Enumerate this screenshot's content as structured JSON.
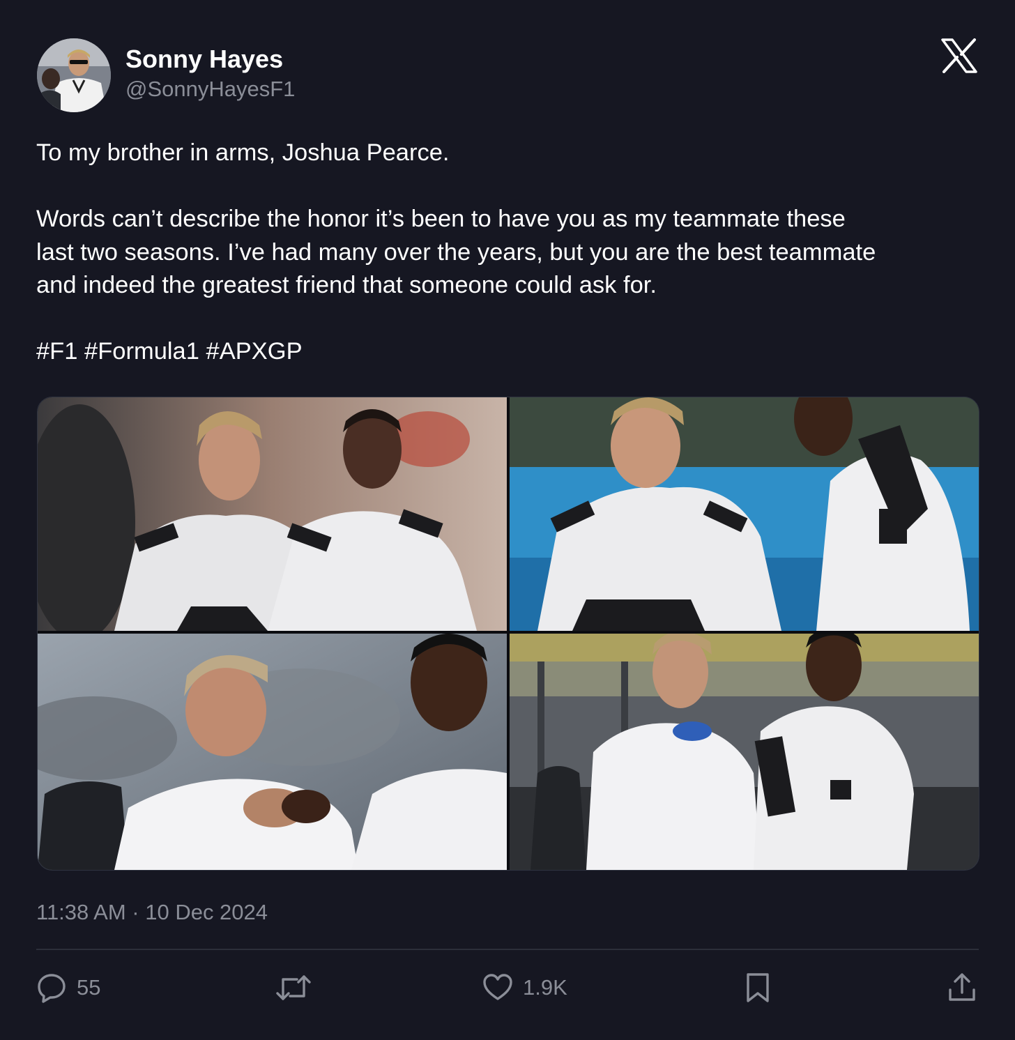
{
  "author": {
    "display_name": "Sonny Hayes",
    "handle": "@SonnyHayesF1"
  },
  "brand_icon": "x-logo-icon",
  "tweet": {
    "lines": [
      "To my brother in arms, Joshua Pearce.",
      "",
      "Words can’t describe the honor it’s been to have you as my teammate these",
      "last two seasons. I’ve had many over the years, but you are the best teammate",
      "and indeed the greatest friend that someone could ask for.",
      "",
      "#F1 #Formula1 #APXGP"
    ]
  },
  "media": {
    "photo_count": 4
  },
  "timestamp": "11:38 AM · 10 Dec 2024",
  "actions": {
    "reply": {
      "icon": "reply-icon",
      "count": "55"
    },
    "retweet": {
      "icon": "retweet-icon"
    },
    "like": {
      "icon": "heart-icon",
      "count": "1.9K"
    },
    "bookmark": {
      "icon": "bookmark-icon"
    },
    "share": {
      "icon": "share-icon"
    }
  },
  "colors": {
    "background": "#161722",
    "primary_text": "#ffffff",
    "secondary_text": "#8b8e98",
    "divider": "#2c2f3a"
  }
}
